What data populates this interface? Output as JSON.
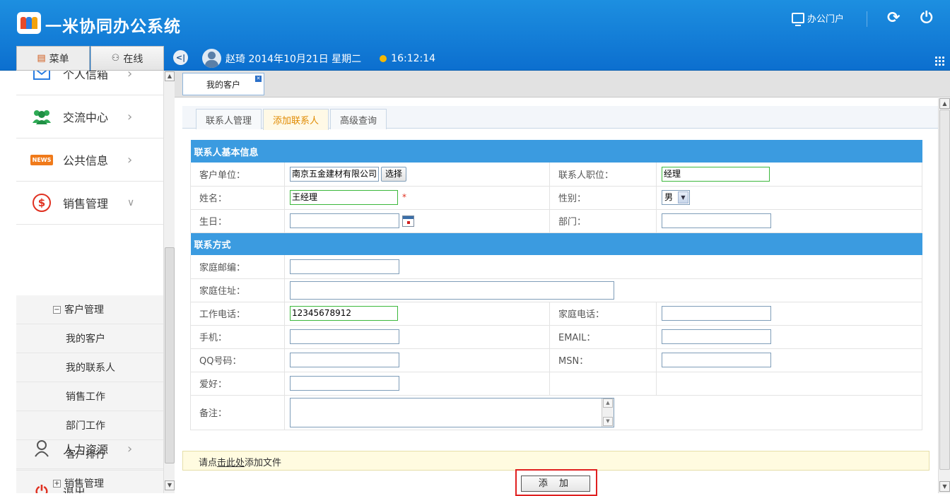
{
  "header": {
    "app_title": "一米协同办公系统",
    "portal_label": "办公门户",
    "refresh_icon": "refresh-icon",
    "power_icon": "power-icon",
    "brand_color": "#1a86d9"
  },
  "topbar": {
    "menu_tab": "菜单",
    "online_tab": "在线",
    "user_name": "赵琦",
    "date": "2014年10月21日 星期二",
    "time": "16:12:14"
  },
  "sidebar": {
    "items": [
      {
        "label": "个人信箱",
        "icon": "mail-icon"
      },
      {
        "label": "交流中心",
        "icon": "people-icon"
      },
      {
        "label": "公共信息",
        "icon": "news-icon",
        "badge": "NEWS"
      },
      {
        "label": "销售管理",
        "icon": "dollar-icon"
      },
      {
        "label": "人力资源",
        "icon": "person-icon"
      },
      {
        "label": "退出",
        "icon": "power-icon"
      }
    ],
    "sub_group": "客户管理",
    "sub_items": [
      "我的客户",
      "我的联系人",
      "销售工作",
      "部门工作",
      "客户排行"
    ],
    "sub_group2": "销售管理",
    "arrow": "›"
  },
  "content": {
    "doc_tab": "我的客户",
    "sub_tabs": [
      "联系人管理",
      "添加联系人",
      "高级查询"
    ],
    "active_sub_tab": "添加联系人"
  },
  "form": {
    "section1": "联系人基本信息",
    "section2": "联系方式",
    "labels": {
      "company": "客户单位：",
      "position": "联系人职位：",
      "name": "姓名：",
      "gender": "性别：",
      "birthday": "生日：",
      "department": "部门：",
      "home_zip": "家庭邮编：",
      "home_address": "家庭住址：",
      "work_phone": "工作电话：",
      "home_phone": "家庭电话：",
      "mobile": "手机：",
      "email": "EMAIL：",
      "qq": "QQ号码：",
      "msn": "MSN：",
      "hobby": "爱好：",
      "remark": "备注："
    },
    "values": {
      "company": "南京五金建材有限公司",
      "position": "经理",
      "name": "王经理",
      "gender": "男",
      "birthday": "",
      "department": "",
      "home_zip": "",
      "home_address": "",
      "work_phone": "12345678912",
      "home_phone": "",
      "mobile": "",
      "email": "",
      "qq": "",
      "msn": "",
      "hobby": "",
      "remark": ""
    },
    "select_button": "选择",
    "required_mark": "*"
  },
  "upload": {
    "prefix": "请点",
    "link": "击此处",
    "suffix": "添加文件"
  },
  "add_button": "添 加",
  "colors": {
    "section_bg": "#3b9be0",
    "active_tab_text": "#e08a00",
    "highlight": "#e02020",
    "valid_border": "#3cb83c"
  }
}
